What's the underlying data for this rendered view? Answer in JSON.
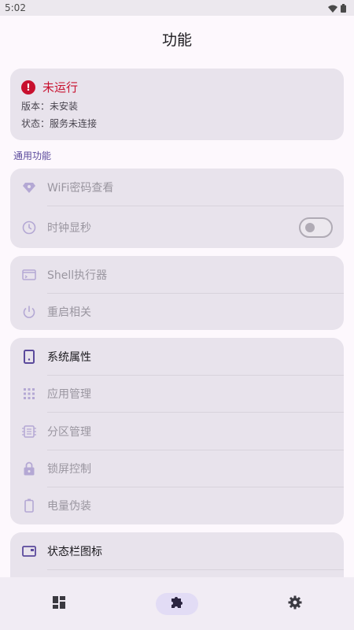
{
  "status_bar": {
    "time": "5:02"
  },
  "page": {
    "title": "功能"
  },
  "status_card": {
    "title": "未运行",
    "version": "版本：未安装",
    "state": "状态：服务未连接"
  },
  "section": {
    "general": "通用功能"
  },
  "group1": {
    "wifi": "WiFi密码查看",
    "clock": "时钟显秒",
    "clock_toggle": "off"
  },
  "group2": {
    "shell": "Shell执行器",
    "reboot": "重启相关"
  },
  "group3": {
    "sysprops": "系统属性",
    "apps": "应用管理",
    "partition": "分区管理",
    "lockscreen": "锁屏控制",
    "battery": "电量伪装"
  },
  "group4": {
    "statusbar": "状态栏图标"
  },
  "nav": {
    "items": [
      {
        "icon": "dashboard-icon",
        "active": false
      },
      {
        "icon": "puzzle-icon",
        "active": true
      },
      {
        "icon": "settings-gear-icon",
        "active": false
      }
    ]
  },
  "colors": {
    "accent": "#5b4a9c",
    "error": "#c8102e",
    "card": "#e8e3ec",
    "disabled_text": "#9a96a0"
  }
}
